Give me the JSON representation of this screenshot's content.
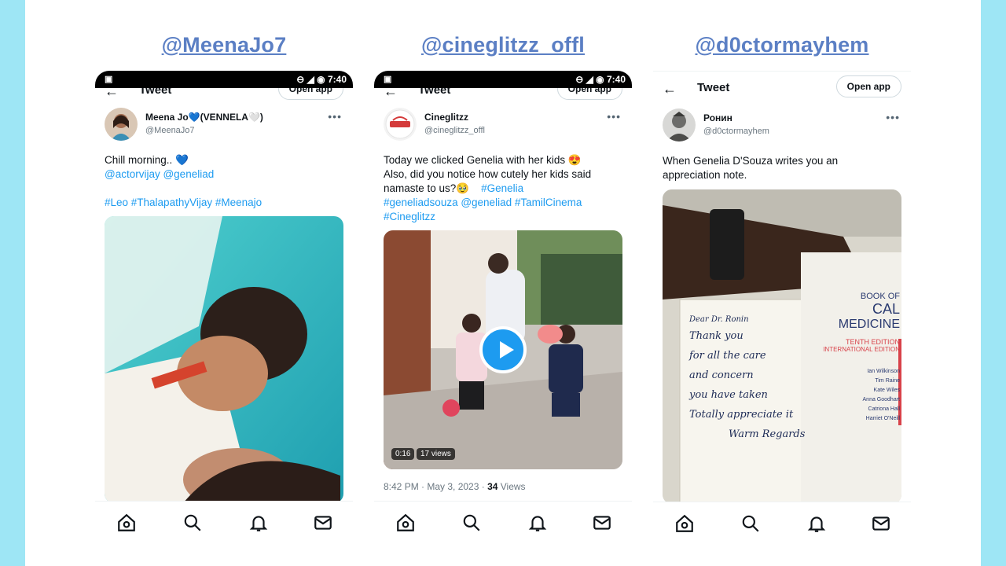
{
  "columns": [
    {
      "handle": "@MeenaJo7",
      "status_time": "7:40",
      "topbar_title": "Tweet",
      "open_app": "Open app",
      "name": "Meena Jo💙(VENNELA🤍)",
      "username": "@MeenaJo7",
      "text_line1": "Chill morning..  💙",
      "mentions": "@actorvijay @geneliad",
      "hashtags": "#Leo #ThalapathyVijay #Meenajo"
    },
    {
      "handle": "@cineglitzz_offl",
      "status_time": "7:40",
      "topbar_title": "Tweet",
      "open_app": "Open app",
      "name": "Cineglitzz",
      "username": "@cineglitzz_offl",
      "text_line1": "Today we clicked Genelia with her kids 😍",
      "text_line2": "Also, did you notice how cutely her kids said",
      "text_line3": "namaste to us?🥹",
      "hashtag_inline": "#Genelia",
      "hashtags_line1": "#geneliadsouza @geneliad #TamilCinema",
      "hashtags_line2": "#Cineglitzz",
      "video_duration": "0:16",
      "video_views": "17 views",
      "meta_time": "8:42 PM · May 3, 2023 · ",
      "meta_views_count": "34",
      "meta_views_label": " Views"
    },
    {
      "handle": "@d0ctormayhem",
      "topbar_title": "Tweet",
      "open_app": "Open app",
      "name": "Ронин",
      "username": "@d0ctormayhem",
      "text_line1": "When Genelia D'Souza writes you an",
      "text_line2": "appreciation note.",
      "note_line1": "Dear Dr. Ronin",
      "note_line2": "Thank you",
      "note_line3": "for all the care",
      "note_line4": "and concern",
      "note_line5": "you have taken",
      "note_line6": "Totally appreciate it",
      "note_line7": "Warm Regards",
      "book_line1": "BOOK OF",
      "book_line2": "CAL",
      "book_line3": "MEDICINE",
      "book_line4": "TENTH EDITION",
      "book_line5": "INTERNATIONAL EDITION",
      "book_authors": [
        "Ian Wilkinson",
        "Tim Raine",
        "Kate Wiles",
        "Anna Goodhart",
        "Catriona Hall",
        "Harriet O'Neill"
      ]
    }
  ],
  "nav": [
    "home-icon",
    "search-icon",
    "notifications-icon",
    "messages-icon"
  ],
  "colors": {
    "background": "#9ee6f5",
    "handle": "#5b7fc4",
    "link": "#1d9bf0"
  }
}
